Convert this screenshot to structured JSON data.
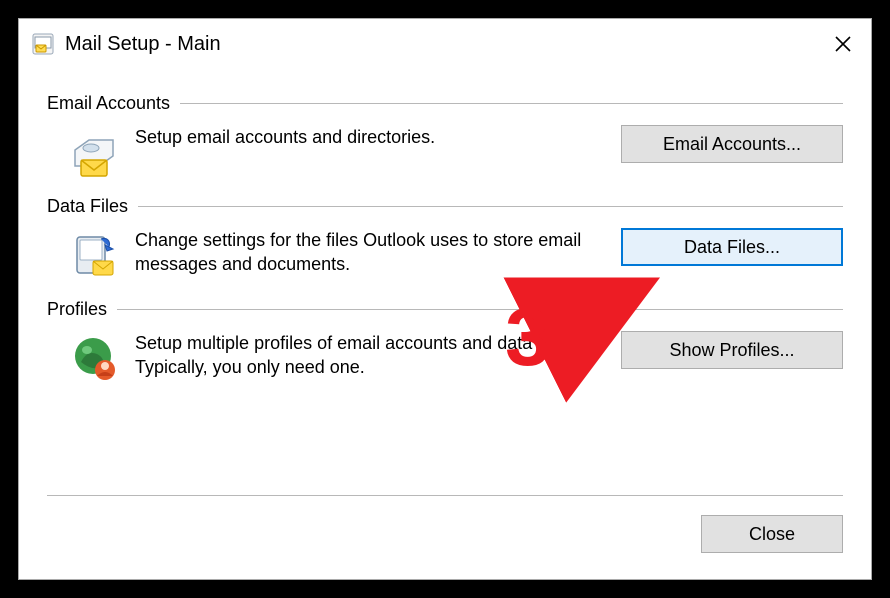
{
  "window": {
    "title": "Mail Setup - Main"
  },
  "sections": {
    "email_accounts": {
      "title": "Email Accounts",
      "description": "Setup email accounts and directories.",
      "button_label": "Email Accounts..."
    },
    "data_files": {
      "title": "Data Files",
      "description": "Change settings for the files Outlook uses to store email messages and documents.",
      "button_label": "Data Files..."
    },
    "profiles": {
      "title": "Profiles",
      "description": "Setup multiple profiles of email accounts and data files. Typically, you only need one.",
      "button_label": "Show Profiles..."
    }
  },
  "footer": {
    "close_label": "Close"
  },
  "annotation": {
    "step_number": "3",
    "color": "#ed1c24"
  }
}
